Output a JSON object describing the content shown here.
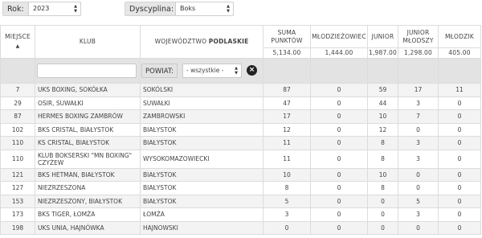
{
  "filters": {
    "year_label": "Rok:",
    "year_value": "2023",
    "discipline_label": "Dyscyplina:",
    "discipline_value": "Boks"
  },
  "table": {
    "headers": {
      "miejsce": "MIEJSCE",
      "klub": "KLUB",
      "wojewodztwo_prefix": "WOJEWÓDZTWO",
      "wojewodztwo_name": "PODLASKIE",
      "suma_line1": "SUMA",
      "suma_line2": "PUNKTÓW",
      "mlodziezowiec": "MŁODZIEŻOWIEC",
      "junior": "JUNIOR",
      "junior_mlodszy_line1": "JUNIOR",
      "junior_mlodszy_line2": "MŁODSZY",
      "mlodzik": "MŁODZIK"
    },
    "sort_icon": "▲",
    "totals": {
      "suma": "5,134.00",
      "mlodziezowiec": "1,444.00",
      "junior": "1,987.00",
      "junior_mlodszy": "1,298.00",
      "mlodzik": "405.00"
    },
    "filter_row": {
      "search_placeholder": "",
      "powiat_label": "POWIAT:",
      "powiat_value": "- wszystkie -",
      "clear_icon": "x-circle-icon"
    },
    "rows": [
      {
        "miejsce": "7",
        "klub": "UKS BOXING, SOKÓŁKA",
        "powiat": "SOKÓLSKI",
        "suma": "87",
        "mlodziezowiec": "0",
        "junior": "59",
        "junior_mlodszy": "17",
        "mlodzik": "11"
      },
      {
        "miejsce": "29",
        "klub": "OSIR, SUWAŁKI",
        "powiat": "SUWAŁKI",
        "suma": "47",
        "mlodziezowiec": "0",
        "junior": "44",
        "junior_mlodszy": "3",
        "mlodzik": "0"
      },
      {
        "miejsce": "87",
        "klub": "HERMES BOXING ZAMBRÓW",
        "powiat": "ZAMBROWSKI",
        "suma": "17",
        "mlodziezowiec": "0",
        "junior": "10",
        "junior_mlodszy": "7",
        "mlodzik": "0"
      },
      {
        "miejsce": "102",
        "klub": "BKS CRISTAL, BIAŁYSTOK",
        "powiat": "BIAŁYSTOK",
        "suma": "12",
        "mlodziezowiec": "0",
        "junior": "12",
        "junior_mlodszy": "0",
        "mlodzik": "0"
      },
      {
        "miejsce": "110",
        "klub": "KS CRISTAL, BIAŁYSTOK",
        "powiat": "BIAŁYSTOK",
        "suma": "11",
        "mlodziezowiec": "0",
        "junior": "8",
        "junior_mlodszy": "3",
        "mlodzik": "0"
      },
      {
        "miejsce": "110",
        "klub": "KLUB BOKSERSKI \"MN BOXING\" CZYŻEW",
        "powiat": "WYSOKOMAZOWIECKI",
        "suma": "11",
        "mlodziezowiec": "0",
        "junior": "8",
        "junior_mlodszy": "3",
        "mlodzik": "0"
      },
      {
        "miejsce": "121",
        "klub": "BKS HETMAN, BIAŁYSTOK",
        "powiat": "BIAŁYSTOK",
        "suma": "10",
        "mlodziezowiec": "0",
        "junior": "10",
        "junior_mlodszy": "0",
        "mlodzik": "0"
      },
      {
        "miejsce": "127",
        "klub": "NIEZRZESZONA",
        "powiat": "BIAŁYSTOK",
        "suma": "8",
        "mlodziezowiec": "0",
        "junior": "8",
        "junior_mlodszy": "0",
        "mlodzik": "0"
      },
      {
        "miejsce": "153",
        "klub": "NIEZRZESZONY, BIAŁYSTOK",
        "powiat": "BIAŁYSTOK",
        "suma": "5",
        "mlodziezowiec": "0",
        "junior": "0",
        "junior_mlodszy": "5",
        "mlodzik": "0"
      },
      {
        "miejsce": "173",
        "klub": "BKS TIGER, ŁOMŻA",
        "powiat": "ŁOMŻA",
        "suma": "3",
        "mlodziezowiec": "0",
        "junior": "0",
        "junior_mlodszy": "3",
        "mlodzik": "0"
      },
      {
        "miejsce": "198",
        "klub": "UKS UNIA, HAJNÓWKA",
        "powiat": "HAJNOWSKI",
        "suma": "0",
        "mlodziezowiec": "0",
        "junior": "0",
        "junior_mlodszy": "0",
        "mlodzik": "0"
      }
    ]
  }
}
